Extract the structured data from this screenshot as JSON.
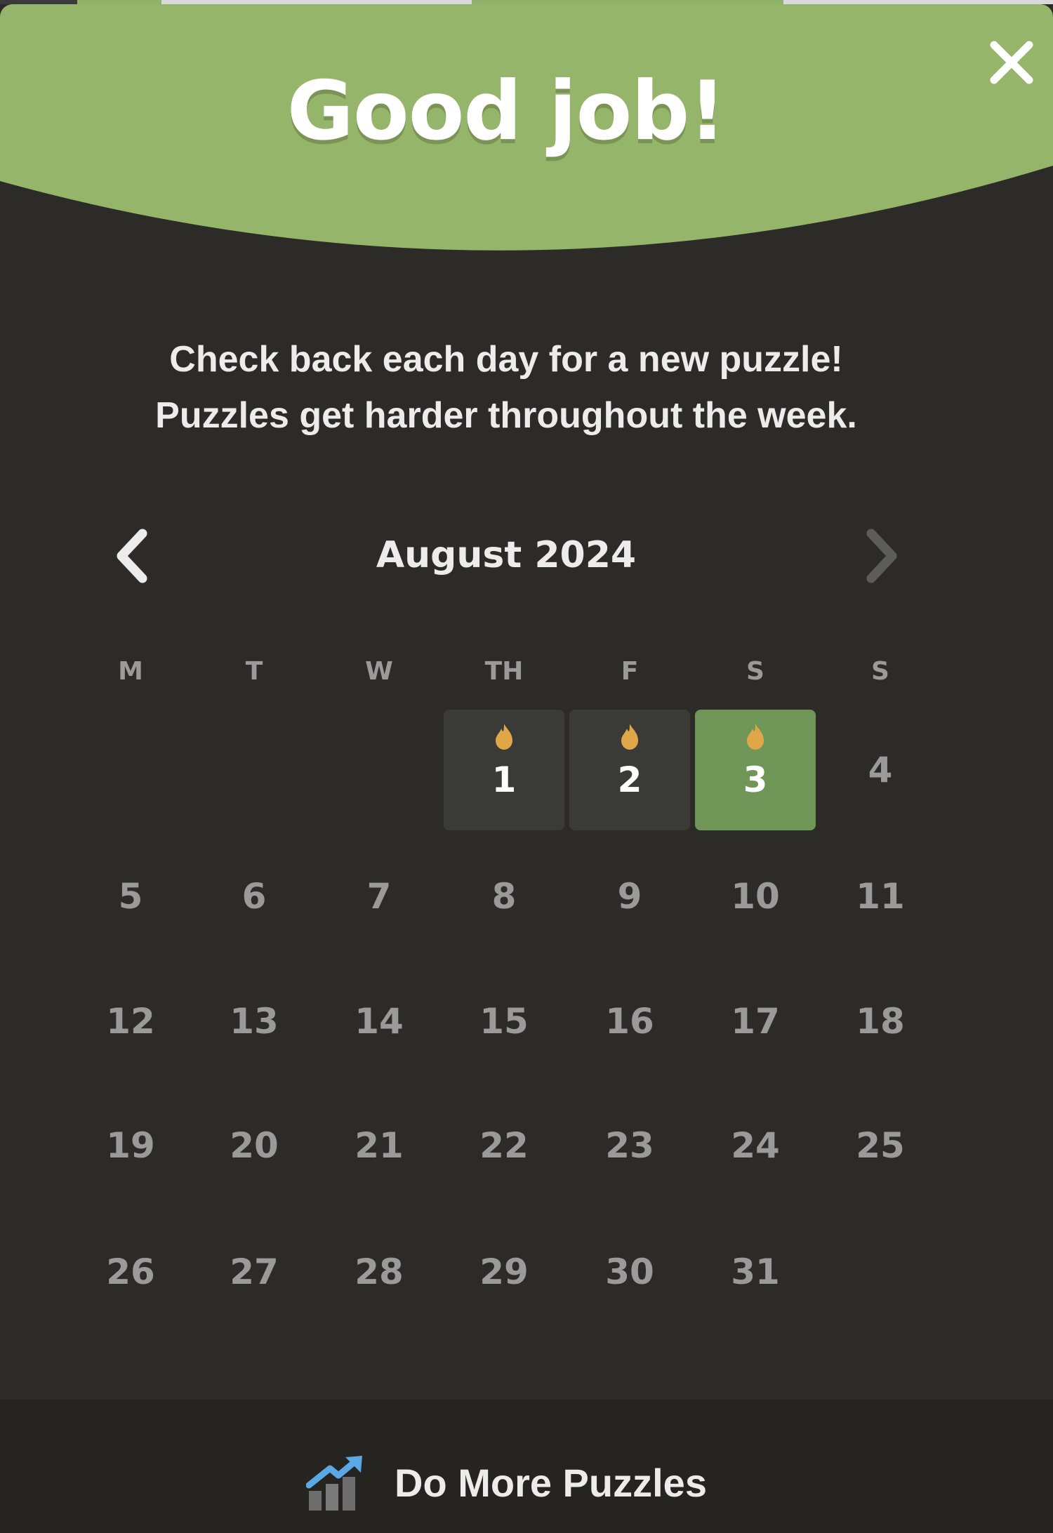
{
  "modal": {
    "title": "Good job!",
    "subtitle_line1": "Check back each day for a new puzzle!",
    "subtitle_line2": "Puzzles get harder throughout the week.",
    "close_icon": "close-icon"
  },
  "calendar": {
    "month_label": "August 2024",
    "prev_icon": "chevron-left-icon",
    "next_icon": "chevron-right-icon",
    "weekdays": [
      "M",
      "T",
      "W",
      "TH",
      "F",
      "S",
      "S"
    ],
    "days": [
      "1",
      "2",
      "3",
      "4",
      "5",
      "6",
      "7",
      "8",
      "9",
      "10",
      "11",
      "12",
      "13",
      "14",
      "15",
      "16",
      "17",
      "18",
      "19",
      "20",
      "21",
      "22",
      "23",
      "24",
      "25",
      "26",
      "27",
      "28",
      "29",
      "30",
      "31"
    ],
    "played_days": [
      "1",
      "2"
    ],
    "today": "3",
    "streak_icon": "flame-icon"
  },
  "footer": {
    "label": "Do More Puzzles",
    "icon": "chart-arrow-icon"
  },
  "colors": {
    "header_green": "#95b56a",
    "today_green": "#6f9657",
    "background": "#2c2b28",
    "played_cell": "#3a3a37",
    "flame": "#e0a748",
    "text_muted": "#9a9a9a"
  }
}
